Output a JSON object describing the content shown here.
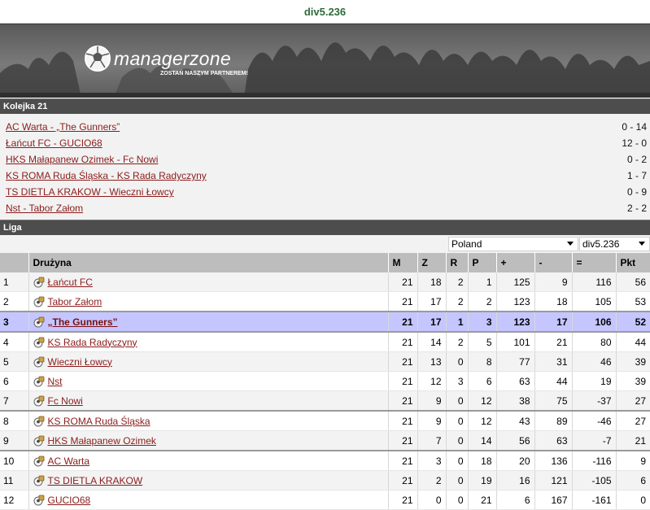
{
  "header": {
    "title": "div5.236"
  },
  "banner": {
    "brand": "managerzone",
    "tagline": "ZOSTAŃ NASZYM PARTNEREM!"
  },
  "round": {
    "label": "Kolejka 21",
    "matches": [
      {
        "teams": "AC Warta - „The Gunners”",
        "score": "0 - 14"
      },
      {
        "teams": "Łańcut FC - GUCIO68",
        "score": "12 - 0"
      },
      {
        "teams": "HKS Małapanew Ozimek - Fc Nowi",
        "score": "0 - 2"
      },
      {
        "teams": "KS ROMA Ruda Śląska - KS Rada Radyczyny",
        "score": "1 - 7"
      },
      {
        "teams": "TS DIETLA KRAKOW - Wieczni Łowcy",
        "score": "0 - 9"
      },
      {
        "teams": "Nst - Tabor Załom",
        "score": "2 - 2"
      }
    ]
  },
  "league": {
    "label": "Liga",
    "country_select": "Poland",
    "division_select": "div5.236",
    "columns": [
      "",
      "Drużyna",
      "M",
      "Z",
      "R",
      "P",
      "+",
      "-",
      "=",
      "Pkt"
    ],
    "rows": [
      {
        "pos": "1",
        "team": "Łańcut FC",
        "m": "21",
        "z": "18",
        "r": "2",
        "p": "1",
        "gf": "125",
        "ga": "9",
        "gd": "116",
        "pts": "56"
      },
      {
        "pos": "2",
        "team": "Tabor Załom",
        "m": "21",
        "z": "17",
        "r": "2",
        "p": "2",
        "gf": "123",
        "ga": "18",
        "gd": "105",
        "pts": "53"
      },
      {
        "pos": "3",
        "team": "„The Gunners”",
        "m": "21",
        "z": "17",
        "r": "1",
        "p": "3",
        "gf": "123",
        "ga": "17",
        "gd": "106",
        "pts": "52"
      },
      {
        "pos": "4",
        "team": "KS Rada Radyczyny",
        "m": "21",
        "z": "14",
        "r": "2",
        "p": "5",
        "gf": "101",
        "ga": "21",
        "gd": "80",
        "pts": "44"
      },
      {
        "pos": "5",
        "team": "Wieczni Łowcy",
        "m": "21",
        "z": "13",
        "r": "0",
        "p": "8",
        "gf": "77",
        "ga": "31",
        "gd": "46",
        "pts": "39"
      },
      {
        "pos": "6",
        "team": "Nst",
        "m": "21",
        "z": "12",
        "r": "3",
        "p": "6",
        "gf": "63",
        "ga": "44",
        "gd": "19",
        "pts": "39"
      },
      {
        "pos": "7",
        "team": "Fc Nowi",
        "m": "21",
        "z": "9",
        "r": "0",
        "p": "12",
        "gf": "38",
        "ga": "75",
        "gd": "-37",
        "pts": "27"
      },
      {
        "pos": "8",
        "team": "KS ROMA Ruda Śląska",
        "m": "21",
        "z": "9",
        "r": "0",
        "p": "12",
        "gf": "43",
        "ga": "89",
        "gd": "-46",
        "pts": "27"
      },
      {
        "pos": "9",
        "team": "HKS Małapanew Ozimek",
        "m": "21",
        "z": "7",
        "r": "0",
        "p": "14",
        "gf": "56",
        "ga": "63",
        "gd": "-7",
        "pts": "21"
      },
      {
        "pos": "10",
        "team": "AC Warta",
        "m": "21",
        "z": "3",
        "r": "0",
        "p": "18",
        "gf": "20",
        "ga": "136",
        "gd": "-116",
        "pts": "9"
      },
      {
        "pos": "11",
        "team": "TS DIETLA KRAKOW",
        "m": "21",
        "z": "2",
        "r": "0",
        "p": "19",
        "gf": "16",
        "ga": "121",
        "gd": "-105",
        "pts": "6"
      },
      {
        "pos": "12",
        "team": "GUCIO68",
        "m": "21",
        "z": "0",
        "r": "0",
        "p": "21",
        "gf": "6",
        "ga": "167",
        "gd": "-161",
        "pts": "0"
      }
    ]
  },
  "colors": {
    "link": "#8b1c1c",
    "title_green": "#2e6b3a",
    "highlight_row": "#c5c6ff",
    "section_bar": "#4d4d4d"
  },
  "icons": {
    "team": "soccer-ball-shirt-icon",
    "logo": "soccer-ball-icon"
  }
}
